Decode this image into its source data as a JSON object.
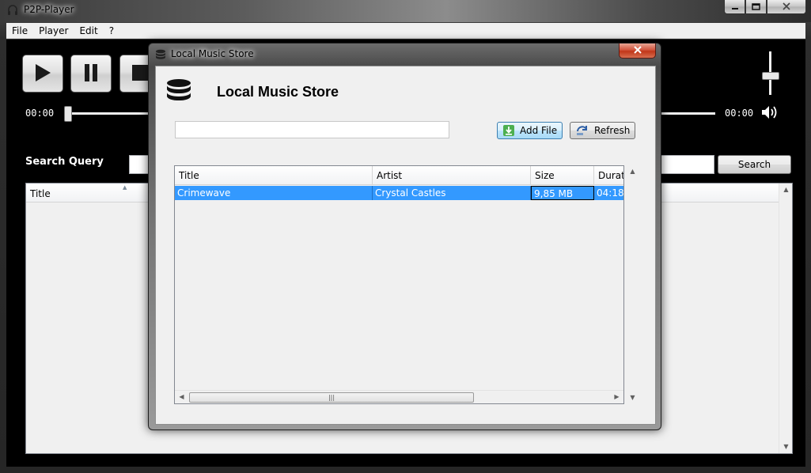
{
  "main_window": {
    "title": "P2P-Player",
    "menu": [
      "File",
      "Player",
      "Edit",
      "?"
    ],
    "player": {
      "time_elapsed": "00:00",
      "time_total": "00:00",
      "seek_position": 0,
      "volume_level": 0.55
    },
    "search": {
      "label": "Search Query",
      "input_value": "",
      "button_label": "Search"
    },
    "results": {
      "columns": [
        "Title"
      ],
      "rows": []
    }
  },
  "dialog": {
    "window_title": "Local Music Store",
    "heading": "Local Music Store",
    "filter_value": "",
    "add_file_label": "Add File",
    "refresh_label": "Refresh",
    "table": {
      "columns": {
        "title": "Title",
        "artist": "Artist",
        "size": "Size",
        "duration": "Durati"
      },
      "rows": [
        {
          "title": "Crimewave",
          "artist": "Crystal Castles",
          "size": "9,85 MB",
          "duration": "04:18",
          "selected": true
        }
      ]
    }
  },
  "icons": {
    "app": "headphones-icon",
    "play": "play-icon",
    "pause": "pause-icon",
    "stop": "stop-icon",
    "volume": "speaker-icon",
    "store": "database-icon",
    "add_file": "download-icon",
    "refresh": "refresh-icon"
  },
  "colors": {
    "selection": "#3399ff",
    "dialog_close": "#c13619",
    "add_file_button": "#bee6fd"
  }
}
